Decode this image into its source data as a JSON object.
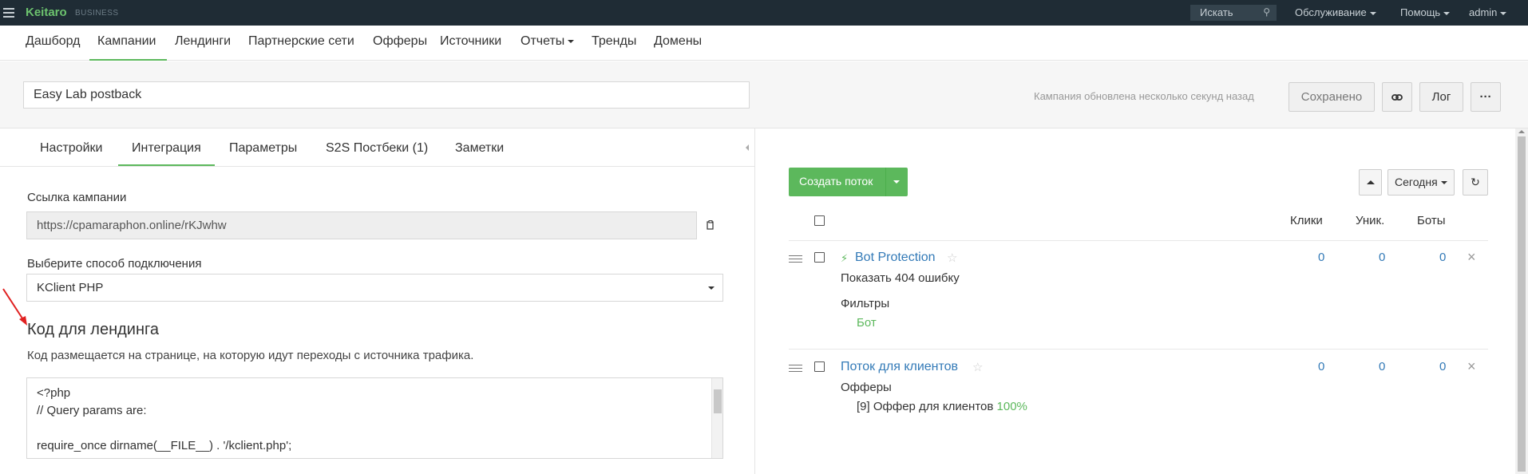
{
  "topbar": {
    "brand": "Keitaro",
    "brand_sub": "BUSINESS",
    "search_placeholder": "Искать",
    "menu": [
      "Обслуживание",
      "Помощь",
      "admin"
    ]
  },
  "nav": {
    "items": [
      "Дашборд",
      "Кампании",
      "Лендинги",
      "Партнерские сети",
      "Офферы",
      "Источники",
      "Отчеты",
      "Тренды",
      "Домены"
    ],
    "active": "Кампании"
  },
  "campaign": {
    "name": "Easy Lab postback",
    "updated_text": "Кампания обновлена несколько секунд назад",
    "saved_label": "Сохранено",
    "log_label": "Лог",
    "more_label": "···"
  },
  "tabs": [
    "Настройки",
    "Интеграция",
    "Параметры",
    "S2S Постбеки (1)",
    "Заметки"
  ],
  "integration": {
    "link_label": "Ссылка кампании",
    "link_value": "https://cpamaraphon.online/rKJwhw",
    "method_label": "Выберите способ подключения",
    "method_value": "KClient PHP",
    "code_title": "Код для лендинга",
    "code_desc": "Код размещается на странице, на которую идут переходы с источника трафика.",
    "code_lines": [
      "<?php",
      "// Query params are:",
      "",
      "require_once dirname(__FILE__) . '/kclient.php';"
    ]
  },
  "flows_toolbar": {
    "create_label": "Создать поток",
    "period_label": "Сегодня"
  },
  "columns": [
    "Клики",
    "Уник.",
    "Боты"
  ],
  "flows": [
    {
      "name": "Bot Protection",
      "action": "Показать 404 ошибку",
      "section_label": "Фильтры",
      "detail": "Бот",
      "clicks": "0",
      "uniques": "0",
      "bots": "0"
    },
    {
      "name": "Поток для клиентов",
      "section_label": "Офферы",
      "detail_prefix": "[9] Оффер для клиентов",
      "detail_pct": "100%",
      "clicks": "0",
      "uniques": "0",
      "bots": "0"
    }
  ],
  "colors": {
    "topbar": "#1f2c35",
    "accent": "#5cb85c",
    "link": "#337ab7"
  }
}
